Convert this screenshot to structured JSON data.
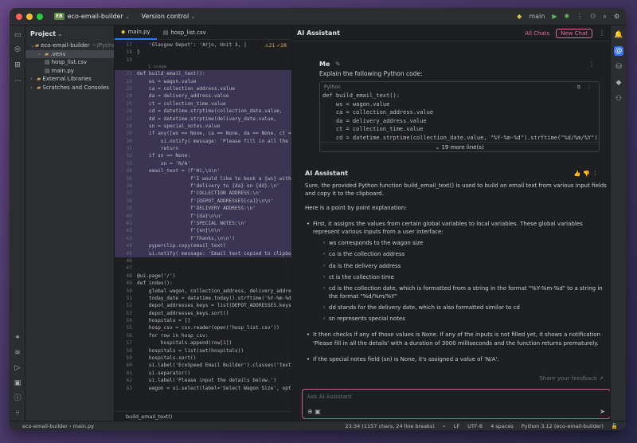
{
  "titlebar": {
    "project_badge": "EB",
    "project_name": "eco-email-builder",
    "version_control": "Version control",
    "branch": "main"
  },
  "project_panel": {
    "title": "Project",
    "tree": [
      {
        "label": "eco-email-builder",
        "suffix": "~/Pycharm",
        "type": "folder",
        "indent": 0,
        "selected": false
      },
      {
        "label": ".venv",
        "suffix": "",
        "type": "folder",
        "indent": 1,
        "selected": true
      },
      {
        "label": "hosp_list.csv",
        "suffix": "",
        "type": "file",
        "indent": 1,
        "selected": false
      },
      {
        "label": "main.py",
        "suffix": "",
        "type": "file",
        "indent": 1,
        "selected": false
      },
      {
        "label": "External Libraries",
        "suffix": "",
        "type": "folder",
        "indent": 0,
        "selected": false
      },
      {
        "label": "Scratches and Consoles",
        "suffix": "",
        "type": "folder",
        "indent": 0,
        "selected": false
      }
    ]
  },
  "editor": {
    "tabs": [
      "main.py",
      "hosp_list.csv"
    ],
    "inspections": "⚠21 ✓28",
    "usage_hint": "1 usage",
    "footer": "build_email_text()",
    "lines_top": [
      {
        "n": "17",
        "t": "    'Glasgow Depot': 'Arjo, Unit 3, |"
      },
      {
        "n": "18",
        "t": "}"
      },
      {
        "n": "19",
        "t": ""
      }
    ],
    "lines_hl": [
      {
        "n": "21",
        "t": "def build_email_text():"
      },
      {
        "n": "22",
        "t": "    ws = wagon.value"
      },
      {
        "n": "23",
        "t": "    ca = collection_address.value"
      },
      {
        "n": "24",
        "t": "    da = delivery_address.value"
      },
      {
        "n": "25",
        "t": "    ct = collection_time.value"
      },
      {
        "n": "26",
        "t": "    cd = datetime.strptime(collection_date.value, "
      },
      {
        "n": "27",
        "t": "    dd = datetime.strptime(delivery_date.value, "
      },
      {
        "n": "28",
        "t": "    sn = special_notes.value"
      },
      {
        "n": "29",
        "t": "    if any([ws == None, ca == None, da == None, ct =="
      },
      {
        "n": "30",
        "t": "        ui.notify( message: 'Please fill in all the de"
      },
      {
        "n": "31",
        "t": "        return"
      },
      {
        "n": "32",
        "t": "    if sn == None:"
      },
      {
        "n": "33",
        "t": "        sn = 'N/A'"
      },
      {
        "n": "34",
        "t": "    email_text = (f'Hi,\\n\\n'"
      },
      {
        "n": "35",
        "t": "                  f'I would like to book a {ws} with"
      },
      {
        "n": "36",
        "t": "                  f'delivery to {da} on {dd}.\\n'"
      },
      {
        "n": "37",
        "t": "                  f'COLLECTION ADDRESS:\\n'"
      },
      {
        "n": "38",
        "t": "                  f'{DEPOT_ADDRESSES[ca]}\\n\\n'"
      },
      {
        "n": "39",
        "t": "                  f'DELIVERY ADDRESS:\\n'"
      },
      {
        "n": "40",
        "t": "                  f'{da}\\n\\n'"
      },
      {
        "n": "41",
        "t": "                  f'SPECIAL NOTES:\\n'"
      },
      {
        "n": "42",
        "t": "                  f'{sn}\\n\\n'"
      },
      {
        "n": "43",
        "t": "                  f'Thanks,\\n\\n')"
      },
      {
        "n": "44",
        "t": "    pyperclip.copy(email_text)"
      },
      {
        "n": "45",
        "t": "    ui.notify( message: 'Email text copied to clipboar"
      }
    ],
    "lines_bottom": [
      {
        "n": "46",
        "t": ""
      },
      {
        "n": "47",
        "t": ""
      },
      {
        "n": "48",
        "t": "@ui.page('/')"
      },
      {
        "n": "49",
        "t": "def index():"
      },
      {
        "n": "50",
        "t": "    global wagon, collection_address, delivery_addres"
      },
      {
        "n": "51",
        "t": "    today_date = datetime.today().strftime('%Y-%m-%d'"
      },
      {
        "n": "52",
        "t": "    depot_addresses_keys = list(DEPOT_ADDRESSES.keys("
      },
      {
        "n": "53",
        "t": "    depot_addresses_keys.sort()"
      },
      {
        "n": "54",
        "t": "    hospitals = []"
      },
      {
        "n": "55",
        "t": "    hosp_csv = csv.reader(open('hosp_list.csv'))"
      },
      {
        "n": "56",
        "t": "    for row in hosp_csv:"
      },
      {
        "n": "57",
        "t": "        hospitals.append(row[1])"
      },
      {
        "n": "58",
        "t": "    hospitals = list(set(hospitals))"
      },
      {
        "n": "59",
        "t": "    hospitals.sort()"
      },
      {
        "n": "60",
        "t": "    ui.label('EcoSpeed Email Builder').classes('text-"
      },
      {
        "n": "61",
        "t": "    ui.separator()"
      },
      {
        "n": "62",
        "t": "    ui.label('Please input the details below.')"
      },
      {
        "n": "63",
        "t": "    wagon = ui.select(label='Select Wagon Size', opti"
      }
    ]
  },
  "ai": {
    "title": "AI Assistant",
    "all_chats": "All Chats",
    "new_chat": "New Chat",
    "user_name": "Me",
    "user_prompt": "Explain the following Python code:",
    "code_lang": "Python",
    "code_lines": [
      "def build_email_text():",
      "    ws = wagon.value",
      "    ca = collection_address.value",
      "    da = delivery_address.value",
      "    ct = collection_time.value",
      "    cd = datetime.strptime(collection_date.value, \"%Y-%m-%d\").strftime(\"%d/%m/%Y\")"
    ],
    "more_lines": "19 more line(s)",
    "assistant_name": "AI Assistant",
    "intro": "Sure, the provided Python function build_email_text() is used to build an email text from various input fields and copy it to the clipboard.",
    "intro2": "Here is a point by point explanation:",
    "bullet1": "First, it assigns the values from certain global variables to local variables. These global variables represent various inputs from a user interface:",
    "subs": [
      "ws corresponds to the wagon size",
      "ca is the collection address",
      "da is the delivery address",
      "ct is the collection time",
      "cd is the collection date, which is formatted from a string in the format \"%Y-%m-%d\" to a string in the format \"%d/%m/%Y\"",
      "dd stands for the delivery date, which is also formatted similar to cd",
      "sn represents special notes"
    ],
    "bullet2": "It then checks if any of those values is None. If any of the inputs is not filled yet, it shows a notification 'Please fill in all the details' with a duration of 3000 milliseconds and the function returns prematurely.",
    "bullet3": "If the special notes field (sn) is None, it's assigned a value of 'N/A'.",
    "feedback": "Share your feedback ↗",
    "ask_placeholder": "Ask AI Assistant"
  },
  "status": {
    "breadcrumb": "eco-email-builder  ›  main.py",
    "position": "23:34 (1157 chars, 24 line breaks)",
    "line_sep": "LF",
    "encoding": "UTF-8",
    "indent": "4 spaces",
    "interpreter": "Python 3.12 (eco-email-builder)"
  }
}
